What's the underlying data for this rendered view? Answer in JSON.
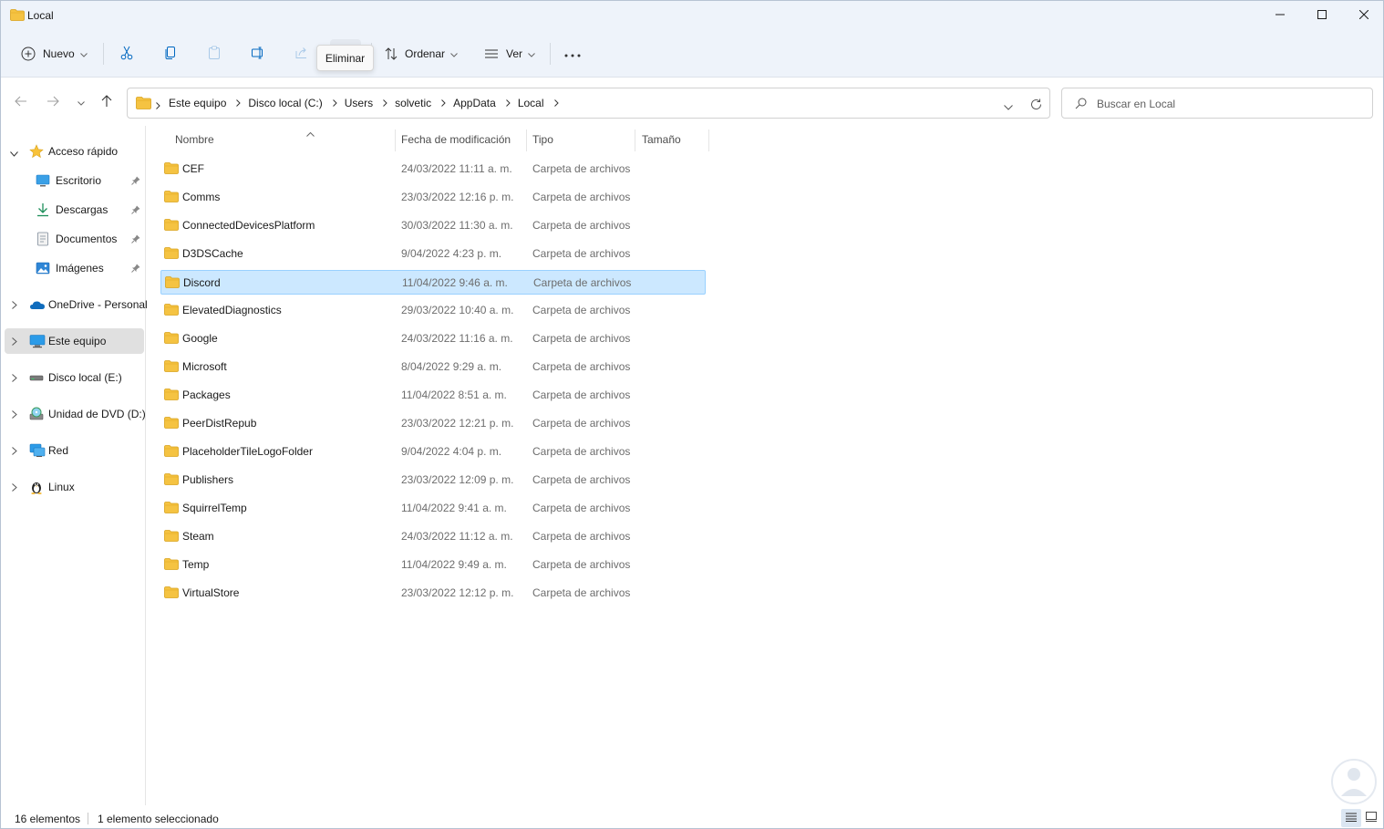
{
  "window": {
    "title": "Local",
    "colors": {
      "chrome": "#eef3fa",
      "selection": "#cce8ff",
      "selection_border": "#99d1ff",
      "folder": "#f5c342",
      "accent": "#0067c0"
    }
  },
  "toolbar": {
    "new_label": "Nuevo",
    "sort_label": "Ordenar",
    "view_label": "Ver",
    "delete_tooltip": "Eliminar",
    "icons": [
      "add-icon",
      "cut-icon",
      "copy-icon",
      "paste-icon",
      "rename-icon",
      "share-icon",
      "delete-icon",
      "sort-icon",
      "view-icon",
      "more-icon"
    ]
  },
  "address": {
    "crumbs": [
      "Este equipo",
      "Disco local (C:)",
      "Users",
      "solvetic",
      "AppData",
      "Local"
    ]
  },
  "search": {
    "placeholder": "Buscar en Local"
  },
  "sidebar": {
    "items": [
      {
        "label": "Acceso rápido",
        "icon": "star-icon"
      },
      {
        "label": "Escritorio",
        "icon": "desktop-icon"
      },
      {
        "label": "Descargas",
        "icon": "download-icon"
      },
      {
        "label": "Documentos",
        "icon": "document-icon"
      },
      {
        "label": "Imágenes",
        "icon": "pictures-icon"
      },
      {
        "label": "OneDrive - Personal",
        "icon": "cloud-icon"
      },
      {
        "label": "Este equipo",
        "icon": "computer-icon"
      },
      {
        "label": "Disco local (E:)",
        "icon": "drive-icon"
      },
      {
        "label": "Unidad de DVD (D:)",
        "icon": "dvd-icon"
      },
      {
        "label": "Red",
        "icon": "network-icon"
      },
      {
        "label": "Linux",
        "icon": "linux-icon"
      }
    ]
  },
  "columns": {
    "name": "Nombre",
    "modified": "Fecha de modificación",
    "type": "Tipo",
    "size": "Tamaño"
  },
  "files": [
    {
      "name": "CEF",
      "date": "24/03/2022 11:11 a. m.",
      "type": "Carpeta de archivos"
    },
    {
      "name": "Comms",
      "date": "23/03/2022 12:16 p. m.",
      "type": "Carpeta de archivos"
    },
    {
      "name": "ConnectedDevicesPlatform",
      "date": "30/03/2022 11:30 a. m.",
      "type": "Carpeta de archivos"
    },
    {
      "name": "D3DSCache",
      "date": "9/04/2022 4:23 p. m.",
      "type": "Carpeta de archivos"
    },
    {
      "name": "Discord",
      "date": "11/04/2022 9:46 a. m.",
      "type": "Carpeta de archivos",
      "selected": true
    },
    {
      "name": "ElevatedDiagnostics",
      "date": "29/03/2022 10:40 a. m.",
      "type": "Carpeta de archivos"
    },
    {
      "name": "Google",
      "date": "24/03/2022 11:16 a. m.",
      "type": "Carpeta de archivos"
    },
    {
      "name": "Microsoft",
      "date": "8/04/2022 9:29 a. m.",
      "type": "Carpeta de archivos"
    },
    {
      "name": "Packages",
      "date": "11/04/2022 8:51 a. m.",
      "type": "Carpeta de archivos"
    },
    {
      "name": "PeerDistRepub",
      "date": "23/03/2022 12:21 p. m.",
      "type": "Carpeta de archivos"
    },
    {
      "name": "PlaceholderTileLogoFolder",
      "date": "9/04/2022 4:04 p. m.",
      "type": "Carpeta de archivos"
    },
    {
      "name": "Publishers",
      "date": "23/03/2022 12:09 p. m.",
      "type": "Carpeta de archivos"
    },
    {
      "name": "SquirrelTemp",
      "date": "11/04/2022 9:41 a. m.",
      "type": "Carpeta de archivos"
    },
    {
      "name": "Steam",
      "date": "24/03/2022 11:12 a. m.",
      "type": "Carpeta de archivos"
    },
    {
      "name": "Temp",
      "date": "11/04/2022 9:49 a. m.",
      "type": "Carpeta de archivos"
    },
    {
      "name": "VirtualStore",
      "date": "23/03/2022 12:12 p. m.",
      "type": "Carpeta de archivos"
    }
  ],
  "status": {
    "count": "16 elementos",
    "selection": "1 elemento seleccionado"
  }
}
